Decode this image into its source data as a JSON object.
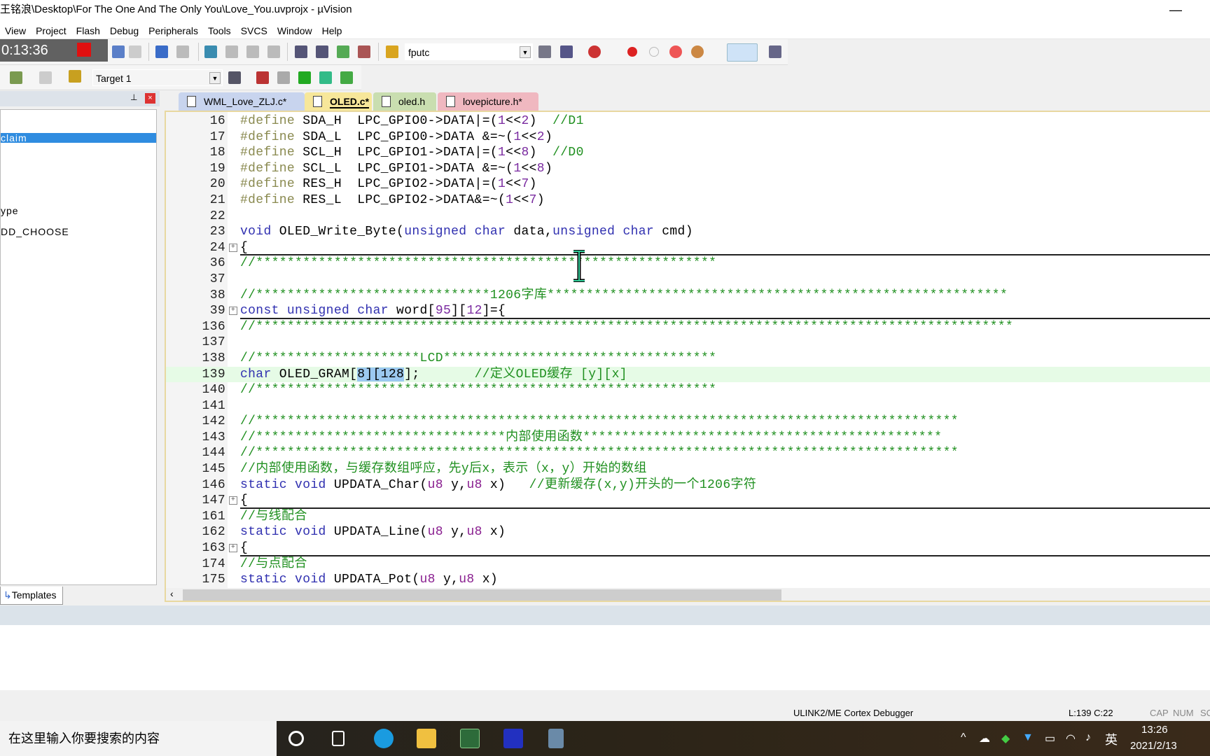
{
  "window": {
    "title": "王铭浪\\Desktop\\For The One And The Only You\\Love_You.uvprojx - µVision",
    "minimize": "—"
  },
  "menu": [
    "View",
    "Project",
    "Flash",
    "Debug",
    "Peripherals",
    "Tools",
    "SVCS",
    "Window",
    "Help"
  ],
  "recorder": {
    "time": "0:13:36"
  },
  "toolbar": {
    "find_value": "fputc",
    "target": "Target 1"
  },
  "left_panel": {
    "items": [
      "claim",
      "ype",
      "DD_CHOOSE"
    ],
    "selected": "claim",
    "bottom_tab": "Templates"
  },
  "tabs": [
    {
      "label": "WML_Love_ZLJ.c*",
      "color": "#c8d4ee"
    },
    {
      "label": "OLED.c*",
      "color": "#f7e79a",
      "active": true
    },
    {
      "label": "oled.h",
      "color": "#c9deb0"
    },
    {
      "label": "lovepicture.h*",
      "color": "#f0b8c0"
    }
  ],
  "code": [
    {
      "n": "16",
      "t": [
        [
          "#define",
          "p"
        ],
        [
          " SDA_H  LPC_GPIO0->DATA|=(",
          ""
        ],
        [
          "1",
          "n"
        ],
        [
          "<<",
          ""
        ],
        [
          "2",
          "n"
        ],
        [
          ")  ",
          ""
        ],
        [
          "//D1",
          "c"
        ]
      ]
    },
    {
      "n": "17",
      "t": [
        [
          "#define",
          "p"
        ],
        [
          " SDA_L  LPC_GPIO0->DATA &=~(",
          ""
        ],
        [
          "1",
          "n"
        ],
        [
          "<<",
          ""
        ],
        [
          "2",
          "n"
        ],
        [
          ")",
          ""
        ]
      ]
    },
    {
      "n": "18",
      "t": [
        [
          "#define",
          "p"
        ],
        [
          " SCL_H  LPC_GPIO1->DATA|=(",
          ""
        ],
        [
          "1",
          "n"
        ],
        [
          "<<",
          ""
        ],
        [
          "8",
          "n"
        ],
        [
          ")  ",
          ""
        ],
        [
          "//D0",
          "c"
        ]
      ]
    },
    {
      "n": "19",
      "t": [
        [
          "#define",
          "p"
        ],
        [
          " SCL_L  LPC_GPIO1->DATA &=~(",
          ""
        ],
        [
          "1",
          "n"
        ],
        [
          "<<",
          ""
        ],
        [
          "8",
          "n"
        ],
        [
          ")",
          ""
        ]
      ]
    },
    {
      "n": "20",
      "t": [
        [
          "#define",
          "p"
        ],
        [
          " RES_H  LPC_GPIO2->DATA|=(",
          ""
        ],
        [
          "1",
          "n"
        ],
        [
          "<<",
          ""
        ],
        [
          "7",
          "n"
        ],
        [
          ")",
          ""
        ]
      ]
    },
    {
      "n": "21",
      "t": [
        [
          "#define",
          "p"
        ],
        [
          " RES_L  LPC_GPIO2->DATA&=~(",
          ""
        ],
        [
          "1",
          "n"
        ],
        [
          "<<",
          ""
        ],
        [
          "7",
          "n"
        ],
        [
          ")",
          ""
        ]
      ]
    },
    {
      "n": "22",
      "t": []
    },
    {
      "n": "23",
      "t": [
        [
          "void",
          "k"
        ],
        [
          " OLED_Write_Byte(",
          ""
        ],
        [
          "unsigned char",
          "k"
        ],
        [
          " data,",
          ""
        ],
        [
          "unsigned char",
          "k"
        ],
        [
          " cmd)",
          ""
        ]
      ]
    },
    {
      "n": "24",
      "fold": true,
      "t": [
        [
          "{",
          ""
        ]
      ]
    },
    {
      "n": "36",
      "t": [
        [
          "//***********************************************************",
          "c"
        ]
      ]
    },
    {
      "n": "37",
      "t": []
    },
    {
      "n": "38",
      "t": [
        [
          "//******************************1206字库***********************************************************",
          "c"
        ]
      ]
    },
    {
      "n": "39",
      "fold": true,
      "t": [
        [
          "const unsigned char",
          "k"
        ],
        [
          " word[",
          ""
        ],
        [
          "95",
          "n"
        ],
        [
          "][",
          ""
        ],
        [
          "12",
          "n"
        ],
        [
          "]={",
          ""
        ]
      ]
    },
    {
      "n": "136",
      "t": [
        [
          "//*************************************************************************************************",
          "c"
        ]
      ]
    },
    {
      "n": "137",
      "t": []
    },
    {
      "n": "138",
      "t": [
        [
          "//*********************LCD***********************************",
          "c"
        ]
      ]
    },
    {
      "n": "139",
      "hl": true,
      "t": [
        [
          "char",
          "k"
        ],
        [
          " OLED_GRAM[",
          ""
        ],
        [
          "8][128",
          "sel"
        ],
        [
          "];       ",
          ""
        ],
        [
          "//定义OLED缓存 [y][x]",
          "c"
        ]
      ]
    },
    {
      "n": "140",
      "t": [
        [
          "//***********************************************************",
          "c"
        ]
      ]
    },
    {
      "n": "141",
      "t": []
    },
    {
      "n": "142",
      "t": [
        [
          "//******************************************************************************************",
          "c"
        ]
      ]
    },
    {
      "n": "143",
      "t": [
        [
          "//********************************内部使用函数**********************************************",
          "c"
        ]
      ]
    },
    {
      "n": "144",
      "t": [
        [
          "//******************************************************************************************",
          "c"
        ]
      ]
    },
    {
      "n": "145",
      "t": [
        [
          "//内部使用函数，与缓存数组呼应，先y后x，表示（x，y）开始的数组",
          "c"
        ]
      ]
    },
    {
      "n": "146",
      "t": [
        [
          "static void",
          "k"
        ],
        [
          " UPDATA_Char(",
          ""
        ],
        [
          "u8",
          "t"
        ],
        [
          " y,",
          ""
        ],
        [
          "u8",
          "t"
        ],
        [
          " x)   ",
          ""
        ],
        [
          "//更新缓存(x,y)开头的一个1206字符",
          "c"
        ]
      ]
    },
    {
      "n": "147",
      "fold": true,
      "t": [
        [
          "{",
          ""
        ]
      ]
    },
    {
      "n": "161",
      "t": [
        [
          "//与线配合",
          "c"
        ]
      ]
    },
    {
      "n": "162",
      "t": [
        [
          "static void",
          "k"
        ],
        [
          " UPDATA_Line(",
          ""
        ],
        [
          "u8",
          "t"
        ],
        [
          " y,",
          ""
        ],
        [
          "u8",
          "t"
        ],
        [
          " x)",
          ""
        ]
      ]
    },
    {
      "n": "163",
      "fold": true,
      "t": [
        [
          "{",
          ""
        ]
      ]
    },
    {
      "n": "174",
      "t": [
        [
          "//与点配合",
          "c"
        ]
      ]
    },
    {
      "n": "175",
      "t": [
        [
          "static void",
          "k"
        ],
        [
          " UPDATA_Pot(",
          ""
        ],
        [
          "u8",
          "t"
        ],
        [
          " y,",
          ""
        ],
        [
          "u8",
          "t"
        ],
        [
          " x)",
          ""
        ]
      ]
    }
  ],
  "statusbar": {
    "debugger": "ULINK2/ME Cortex Debugger",
    "position": "L:139 C:22",
    "cap": "CAP",
    "num": "NUM",
    "scroll": "SC"
  },
  "taskbar": {
    "search_placeholder": "在这里输入你要搜索的内容",
    "ime": "英",
    "time": "13:26",
    "date": "2021/2/13"
  }
}
